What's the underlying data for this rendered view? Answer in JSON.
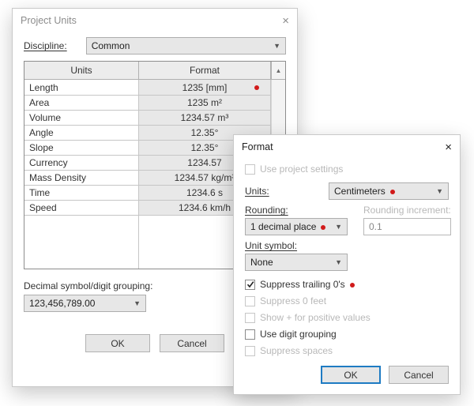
{
  "project_units": {
    "title": "Project Units",
    "discipline_label": "Discipline:",
    "discipline_value": "Common",
    "col_units": "Units",
    "col_format": "Format",
    "rows": [
      {
        "name": "Length",
        "format": "1235 [mm]",
        "dot": true
      },
      {
        "name": "Area",
        "format": "1235 m²",
        "dot": false
      },
      {
        "name": "Volume",
        "format": "1234.57 m³",
        "dot": false
      },
      {
        "name": "Angle",
        "format": "12.35°",
        "dot": false
      },
      {
        "name": "Slope",
        "format": "12.35°",
        "dot": false
      },
      {
        "name": "Currency",
        "format": "1234.57",
        "dot": false
      },
      {
        "name": "Mass Density",
        "format": "1234.57 kg/m³",
        "dot": false
      },
      {
        "name": "Time",
        "format": "1234.6 s",
        "dot": false
      },
      {
        "name": "Speed",
        "format": "1234.6 km/h",
        "dot": false
      }
    ],
    "decimal_label": "Decimal symbol/digit grouping:",
    "decimal_value": "123,456,789.00",
    "ok": "OK",
    "cancel": "Cancel"
  },
  "format": {
    "title": "Format",
    "use_project_settings": "Use project settings",
    "units_label": "Units:",
    "units_value": "Centimeters",
    "rounding_label": "Rounding:",
    "rounding_value": "1 decimal place",
    "rounding_incr_label": "Rounding increment:",
    "rounding_incr_value": "0.1",
    "unit_symbol_label": "Unit symbol:",
    "unit_symbol_value": "None",
    "suppress_trailing": "Suppress trailing 0's",
    "suppress_0_feet": "Suppress 0 feet",
    "show_plus": "Show + for positive values",
    "use_digit_grouping": "Use digit grouping",
    "suppress_spaces": "Suppress spaces",
    "ok": "OK",
    "cancel": "Cancel"
  }
}
